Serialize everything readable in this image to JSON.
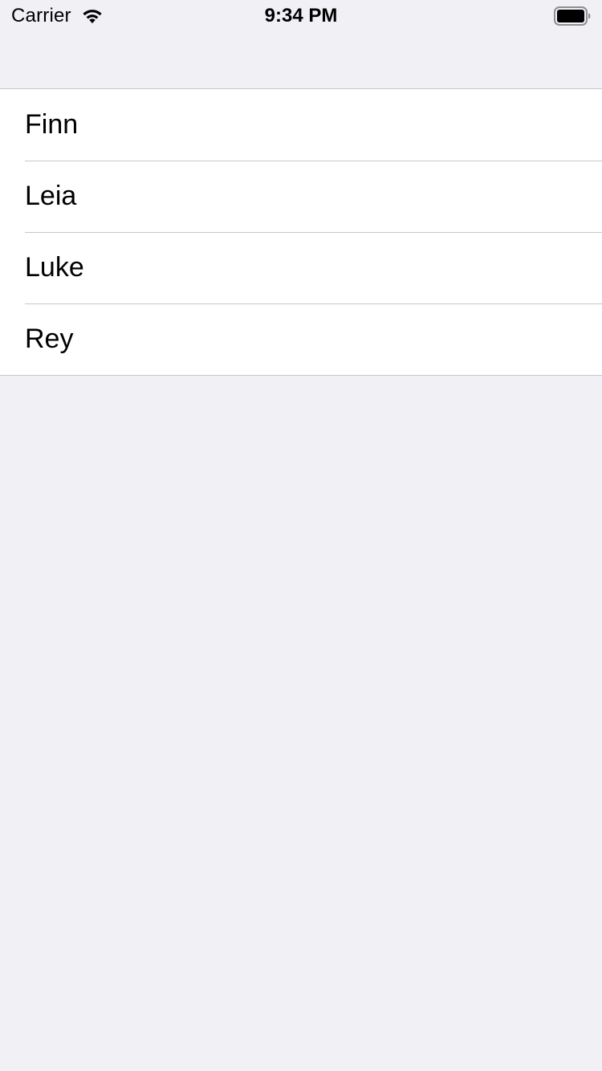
{
  "status_bar": {
    "carrier": "Carrier",
    "time": "9:34 PM",
    "wifi_icon": "wifi-icon",
    "battery_icon": "battery-icon"
  },
  "list": {
    "items": [
      {
        "label": "Finn"
      },
      {
        "label": "Leia"
      },
      {
        "label": "Luke"
      },
      {
        "label": "Rey"
      }
    ]
  },
  "colors": {
    "background": "#f0f0f5",
    "cell_background": "#ffffff",
    "separator": "#c8c7cc",
    "text": "#000000"
  }
}
